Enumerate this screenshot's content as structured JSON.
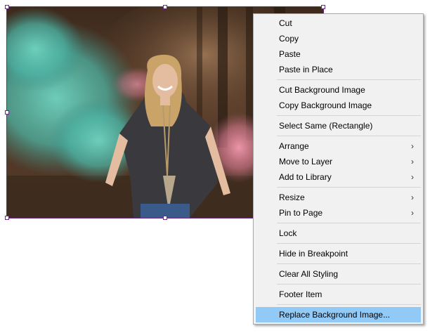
{
  "canvas": {
    "selection_color": "#6a2a8a",
    "image_alt": "Woman holding colored smoke flares in a forest"
  },
  "context_menu": {
    "groups": [
      [
        {
          "label": "Cut",
          "submenu": false
        },
        {
          "label": "Copy",
          "submenu": false
        },
        {
          "label": "Paste",
          "submenu": false
        },
        {
          "label": "Paste in Place",
          "submenu": false
        }
      ],
      [
        {
          "label": "Cut Background Image",
          "submenu": false
        },
        {
          "label": "Copy Background Image",
          "submenu": false
        }
      ],
      [
        {
          "label": "Select Same (Rectangle)",
          "submenu": false
        }
      ],
      [
        {
          "label": "Arrange",
          "submenu": true
        },
        {
          "label": "Move to Layer",
          "submenu": true
        },
        {
          "label": "Add to Library",
          "submenu": true
        }
      ],
      [
        {
          "label": "Resize",
          "submenu": true
        },
        {
          "label": "Pin to Page",
          "submenu": true
        }
      ],
      [
        {
          "label": "Lock",
          "submenu": false
        }
      ],
      [
        {
          "label": "Hide in Breakpoint",
          "submenu": false
        }
      ],
      [
        {
          "label": "Clear All Styling",
          "submenu": false
        }
      ],
      [
        {
          "label": "Footer Item",
          "submenu": false
        }
      ],
      [
        {
          "label": "Replace Background Image...",
          "submenu": false,
          "highlighted": true
        }
      ]
    ],
    "chevron_icon": "chevron-right-icon",
    "highlight_color": "#91c9f7"
  }
}
